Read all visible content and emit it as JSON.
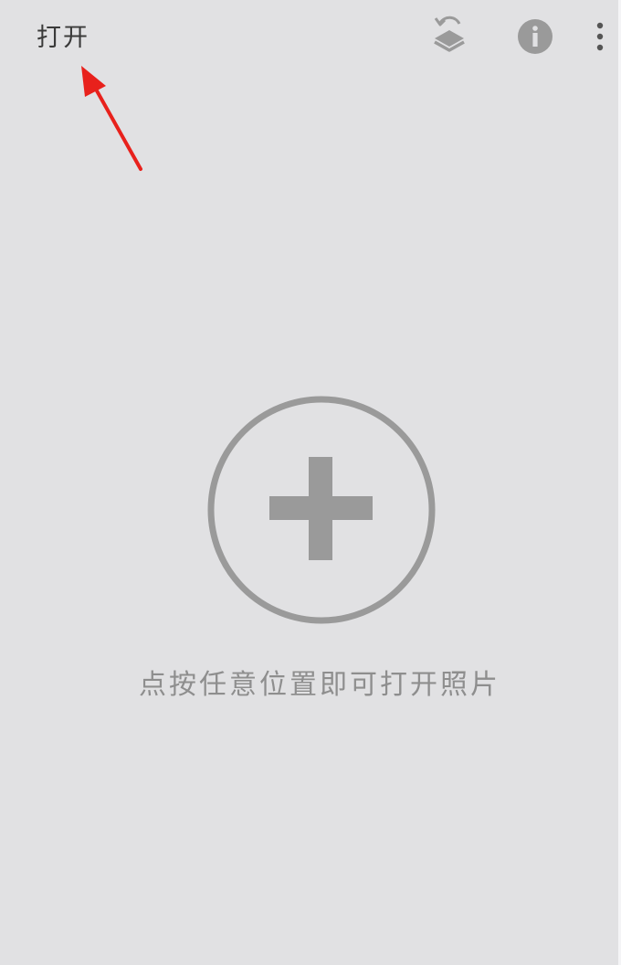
{
  "top_bar": {
    "open_label": "打开",
    "icons": {
      "layers": "layers-undo-icon",
      "info": "info-icon",
      "more": "more-vertical-icon"
    }
  },
  "canvas": {
    "add_icon": "add-circle-icon",
    "hint": "点按任意位置即可打开照片"
  },
  "colors": {
    "background": "#e1e1e3",
    "icon_gray": "#9a9a9a",
    "text_dark": "#3a3a3a",
    "hint_gray": "#8e8e8e",
    "annotation_red": "#e8211c"
  }
}
